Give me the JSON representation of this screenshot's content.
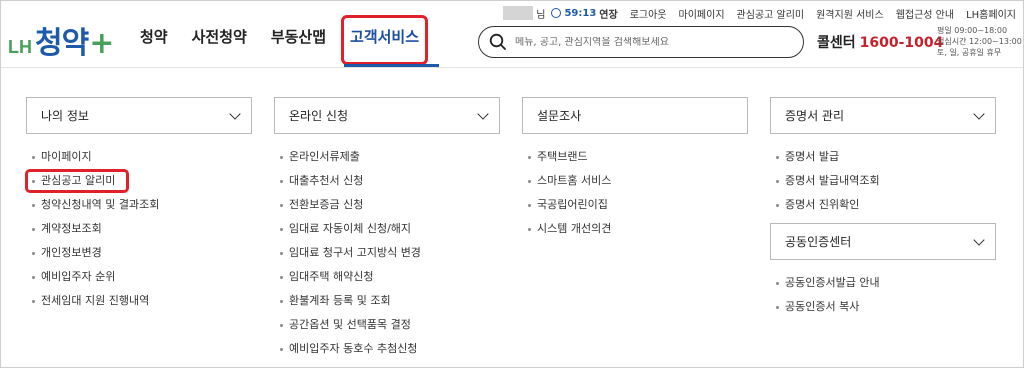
{
  "logo": {
    "prefix": "LH",
    "main": "청약",
    "plus": "+"
  },
  "gnb": [
    {
      "label": "청약"
    },
    {
      "label": "사전청약"
    },
    {
      "label": "부동산맵"
    },
    {
      "label": "고객서비스",
      "active": true
    }
  ],
  "util": {
    "suffix": "님",
    "timer": "59:13",
    "extend": "연장",
    "links": [
      "로그아웃",
      "마이페이지",
      "관심공고 알리미",
      "원격지원 서비스",
      "웹접근성 안내",
      "LH홈페이지"
    ]
  },
  "search": {
    "placeholder": "메뉴, 공고, 관심지역을 검색해보세요"
  },
  "callcenter": {
    "label": "콜센터",
    "number": "1600-1004"
  },
  "hours": {
    "line1": "평일 09:00~18:00",
    "line2": "점심시간 12:00~13:00",
    "line3": "토, 일, 공휴일 휴무"
  },
  "columns": [
    {
      "title": "나의 정보",
      "items": [
        "마이페이지",
        "관심공고 알리미",
        "청약신청내역 및 결과조회",
        "계약정보조회",
        "개인정보변경",
        "예비입주자 순위",
        "전세임대 지원 진행내역"
      ]
    },
    {
      "title": "온라인 신청",
      "items": [
        "온라인서류제출",
        "대출추천서 신청",
        "전환보증금 신청",
        "임대료 자동이체 신청/해지",
        "임대료 청구서 고지방식 변경",
        "임대주택 해약신청",
        "환불계좌 등록 및 조회",
        "공간옵션 및 선택품목 결정",
        "예비입주자 동호수 추첨신청"
      ]
    },
    {
      "title": "설문조사",
      "items": [
        "주택브랜드",
        "스마트홈 서비스",
        "국공립어린이집",
        "시스템 개선의견"
      ]
    },
    {
      "title": "증명서 관리",
      "items": [
        "증명서 발급",
        "증명서 발급내역조회",
        "증명서 진위확인"
      ]
    }
  ],
  "certCenter": {
    "title": "공동인증센터",
    "items": [
      "공동인증서발급 안내",
      "공동인증서 복사"
    ]
  },
  "colors": {
    "accent": "#1d5aa9",
    "highlight": "#e0212b",
    "logoGreen": "#4aa05a",
    "phone": "#c8202a"
  }
}
